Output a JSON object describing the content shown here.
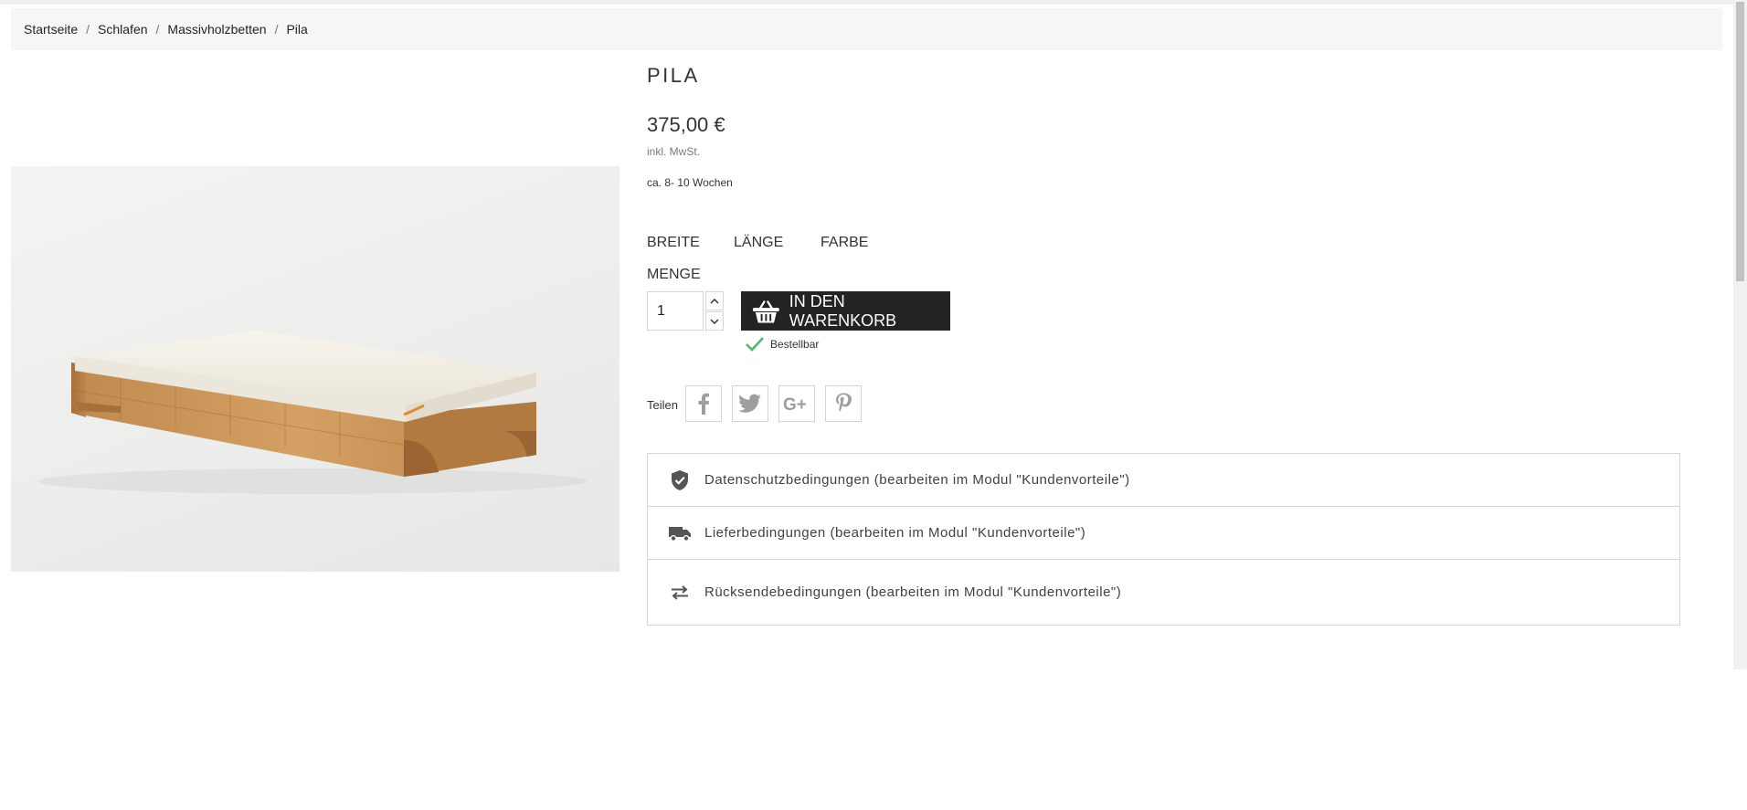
{
  "breadcrumb": {
    "items": [
      "Startseite",
      "Schlafen",
      "Massivholzbetten",
      "Pila"
    ],
    "separator": "/"
  },
  "product": {
    "title": "PILA",
    "price": "375,00 €",
    "tax_note": "inkl. MwSt.",
    "delivery_time": "ca. 8- 10 Wochen",
    "variants": [
      "BREITE",
      "LÄNGE",
      "FARBE"
    ],
    "quantity_label": "MENGE",
    "quantity_value": "1",
    "add_to_cart_label": "IN DEN WARENKORB",
    "availability": "Bestellbar"
  },
  "share": {
    "label": "Teilen",
    "networks": [
      "facebook-icon",
      "twitter-icon",
      "google-plus-icon",
      "pinterest-icon"
    ]
  },
  "reassurance": [
    {
      "icon": "shield-check-icon",
      "text": "Datenschutzbedingungen (bearbeiten im Modul \"Kundenvorteile\")"
    },
    {
      "icon": "truck-icon",
      "text": "Lieferbedingungen (bearbeiten im Modul \"Kundenvorteile\")"
    },
    {
      "icon": "swap-arrows-icon",
      "text": "Rücksendebedingungen (bearbeiten im Modul \"Kundenvorteile\")"
    }
  ],
  "colors": {
    "cart_button": "#232323",
    "availability_check": "#4cbb6c",
    "border": "#d6d4d4",
    "breadcrumb_bg": "#f6f6f6"
  }
}
